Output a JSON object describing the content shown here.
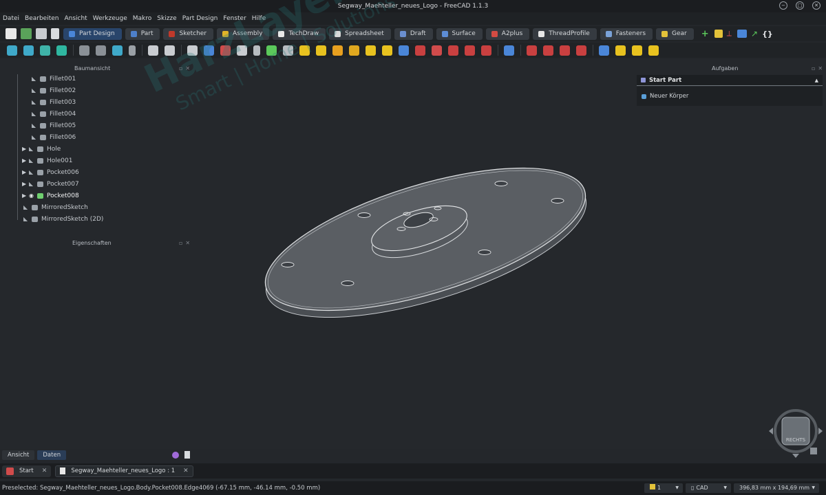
{
  "window": {
    "title": "Segway_Maehteller_neues_Logo - FreeCAD 1.1.3"
  },
  "menu": [
    "Datei",
    "Bearbeiten",
    "Ansicht",
    "Werkzeuge",
    "Makro",
    "Skizze",
    "Part Design",
    "Fenster",
    "Hilfe"
  ],
  "workbenches": [
    {
      "label": "Part Design",
      "color": "#4a86d8",
      "active": true
    },
    {
      "label": "Part",
      "color": "#4d7fc9"
    },
    {
      "label": "Sketcher",
      "color": "#c0392b"
    },
    {
      "label": "Assembly",
      "color": "#e0b428"
    },
    {
      "label": "TechDraw",
      "color": "#e8e8e8"
    },
    {
      "label": "Spreadsheet",
      "color": "#d9d9d9"
    },
    {
      "label": "Draft",
      "color": "#6a8fd0"
    },
    {
      "label": "Surface",
      "color": "#5d8dd6"
    },
    {
      "label": "A2plus",
      "color": "#d34b43"
    },
    {
      "label": "ThreadProfile",
      "color": "#e6e6e6"
    },
    {
      "label": "Fasteners",
      "color": "#7aa2d8"
    },
    {
      "label": "Gear",
      "color": "#e3c23a"
    }
  ],
  "tree_panel": {
    "title": "Baumansicht"
  },
  "tree": [
    {
      "label": "Fillet001",
      "expandable": false
    },
    {
      "label": "Fillet002",
      "expandable": false
    },
    {
      "label": "Fillet003",
      "expandable": false
    },
    {
      "label": "Fillet004",
      "expandable": false
    },
    {
      "label": "Fillet005",
      "expandable": false
    },
    {
      "label": "Fillet006",
      "expandable": false
    },
    {
      "label": "Hole",
      "expandable": true
    },
    {
      "label": "Hole001",
      "expandable": true
    },
    {
      "label": "Pocket006",
      "expandable": true
    },
    {
      "label": "Pocket007",
      "expandable": true
    },
    {
      "label": "Pocket008",
      "expandable": true,
      "selected": true
    },
    {
      "label": "MirroredSketch",
      "expandable": false
    },
    {
      "label": "MirroredSketch (2D)",
      "expandable": false
    }
  ],
  "properties_panel": {
    "title": "Eigenschaften"
  },
  "tasks_panel": {
    "title": "Aufgaben",
    "section": "Start Part",
    "action": "Neuer Körper"
  },
  "watermark": {
    "brand": "HarzLayerLogic",
    "tagline": "Smart | Home | Solutions"
  },
  "navcube": {
    "face": "RECHTS"
  },
  "bottom_tabs": [
    {
      "label": "Ansicht"
    },
    {
      "label": "Daten",
      "active": true
    }
  ],
  "doc_tabs": [
    {
      "label": "Start"
    },
    {
      "label": "Segway_Maehteller_neues_Logo : 1",
      "active": true
    }
  ],
  "status": {
    "text": "Preselected: Segway_Maehteller_neues_Logo.Body.Pocket008.Edge4069 (-67.15 mm, -46.14 mm, -0.50 mm)",
    "page": "1",
    "nav_style": "CAD",
    "dimensions": "396,83 mm x 194,69 mm"
  }
}
